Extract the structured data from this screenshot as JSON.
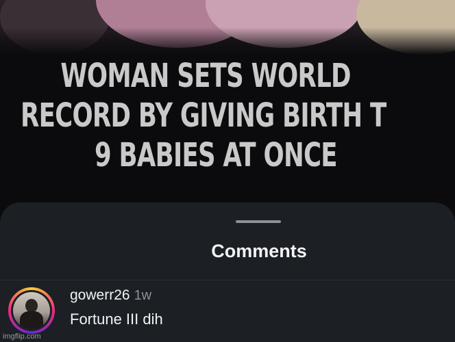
{
  "video": {
    "headline_lines": [
      "WOMAN SETS WORLD",
      "RECORD BY GIVING BIRTH T",
      "9 BABIES AT ONCE"
    ]
  },
  "comments_sheet": {
    "title": "Comments",
    "comments": [
      {
        "username": "gowerr26",
        "time": "1w",
        "text": "Fortune III dih"
      }
    ]
  },
  "watermark": "imgflip.com"
}
